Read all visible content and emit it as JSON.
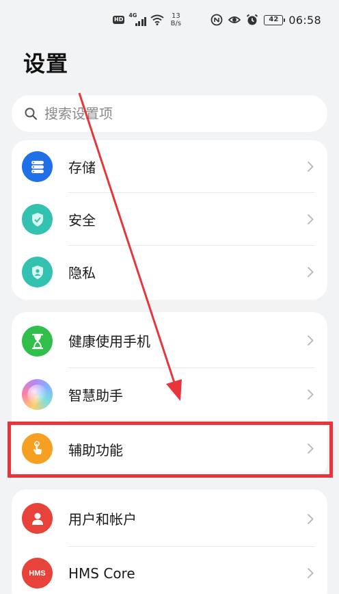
{
  "status_bar": {
    "hd": "HD",
    "network": "4G",
    "net_speed_value": "13",
    "net_speed_unit": "B/s",
    "battery": "42",
    "time": "06:58"
  },
  "title": "设置",
  "search": {
    "placeholder": "搜索设置项"
  },
  "groups": [
    {
      "items": [
        {
          "label": "存储",
          "icon": "storage-icon",
          "color": "#1f6fe8"
        },
        {
          "label": "安全",
          "icon": "shield-check-icon",
          "color": "#33c2b0"
        },
        {
          "label": "隐私",
          "icon": "privacy-icon",
          "color": "#33c2b0"
        }
      ]
    },
    {
      "items": [
        {
          "label": "健康使用手机",
          "icon": "hourglass-icon",
          "color": "#2fbf4a"
        },
        {
          "label": "智慧助手",
          "icon": "assistant-icon",
          "color": "#b887f0"
        },
        {
          "label": "辅助功能",
          "icon": "accessibility-hand-icon",
          "color": "#f5a020"
        }
      ]
    },
    {
      "items": [
        {
          "label": "用户和帐户",
          "icon": "user-icon",
          "color": "#e8433b"
        },
        {
          "label": "HMS Core",
          "icon": "hms-core-icon",
          "icon_text": "HMS",
          "color": "#e8433b"
        }
      ]
    }
  ],
  "annotation": {
    "highlight_color": "#e8343a"
  }
}
